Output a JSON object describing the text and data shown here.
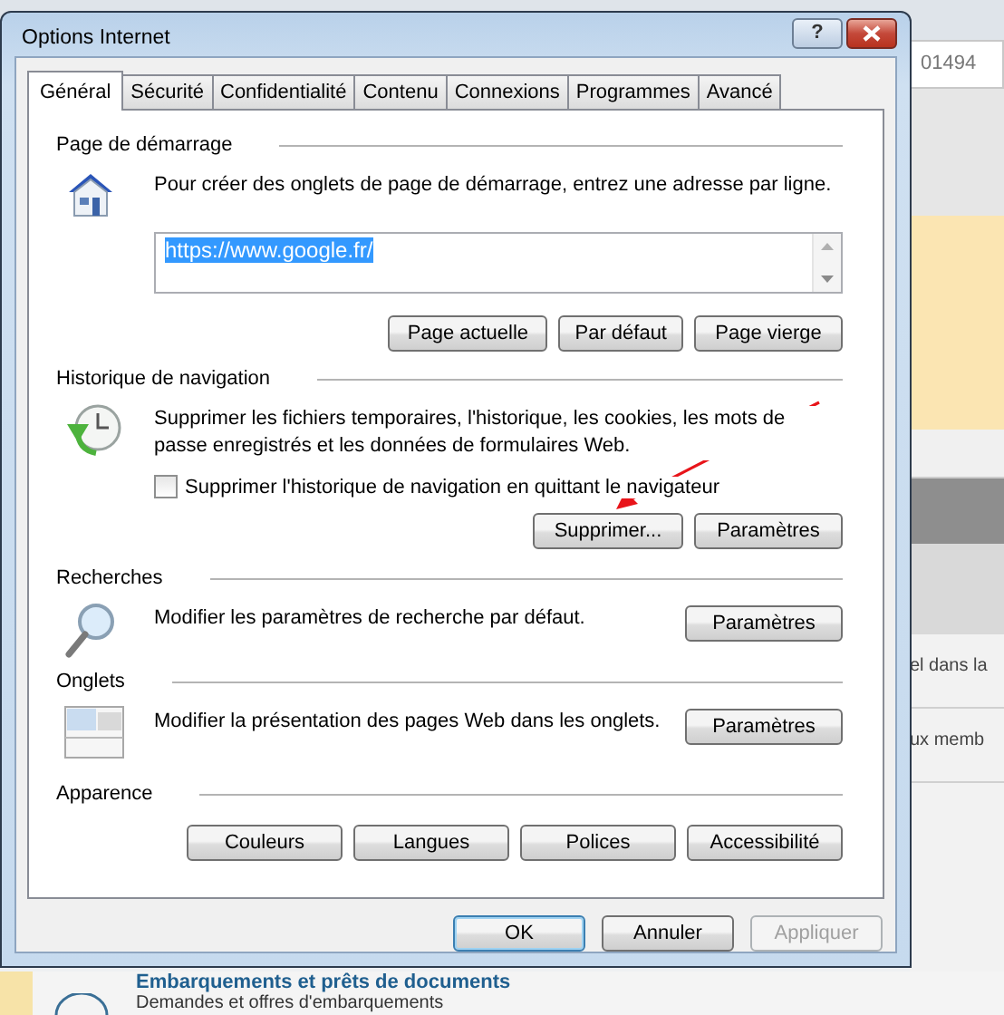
{
  "window": {
    "title": "Options Internet",
    "help_button": "?"
  },
  "tabs": [
    {
      "label": "Général",
      "selected": true
    },
    {
      "label": "Sécurité",
      "selected": false
    },
    {
      "label": "Confidentialité",
      "selected": false
    },
    {
      "label": "Contenu",
      "selected": false
    },
    {
      "label": "Connexions",
      "selected": false
    },
    {
      "label": "Programmes",
      "selected": false
    },
    {
      "label": "Avancé",
      "selected": false
    }
  ],
  "sections": [
    {
      "kind": "home",
      "title": "Page de démarrage",
      "description": "Pour créer des onglets de page de démarrage, entrez une adresse par ligne.",
      "address": {
        "value": "https://www.google.fr/",
        "selected": true
      },
      "buttons": [
        "Page actuelle",
        "Par défaut",
        "Page vierge"
      ]
    },
    {
      "kind": "history",
      "title": "Historique de navigation",
      "description": "Supprimer les fichiers temporaires, l'historique, les cookies, les mots de passe enregistrés et les données de formulaires Web.",
      "checkbox": {
        "label": "Supprimer l'historique de navigation en quittant le navigateur",
        "checked": false
      },
      "buttons": [
        "Supprimer...",
        "Paramètres"
      ]
    },
    {
      "kind": "search",
      "title": "Recherches",
      "description": "Modifier les paramètres de recherche par défaut.",
      "buttons": [
        "Paramètres"
      ]
    },
    {
      "kind": "tabs",
      "title": "Onglets",
      "description": "Modifier la présentation des pages Web dans les onglets.",
      "buttons": [
        "Paramètres"
      ]
    },
    {
      "kind": "appearance",
      "title": "Apparence",
      "buttons": [
        "Couleurs",
        "Langues",
        "Polices",
        "Accessibilité"
      ]
    }
  ],
  "footer_buttons": [
    {
      "label": "OK",
      "default": true,
      "disabled": false
    },
    {
      "label": "Annuler",
      "default": false,
      "disabled": false
    },
    {
      "label": "Appliquer",
      "default": false,
      "disabled": true
    }
  ],
  "background_page": {
    "field_text": "01494",
    "snippets": [
      "el dans la",
      "ux memb"
    ],
    "link": "Embarquements et prêts de documents",
    "subtitle": "Demandes et offres d'embarquements"
  }
}
